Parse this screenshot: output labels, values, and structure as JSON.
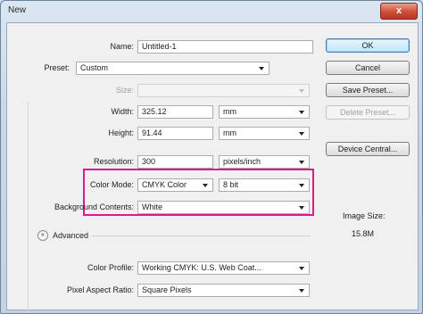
{
  "window": {
    "title": "New",
    "close_glyph": "x"
  },
  "form": {
    "name": {
      "label": "Name:",
      "value": "Untitled-1"
    },
    "preset": {
      "label": "Preset:",
      "value": "Custom"
    },
    "size": {
      "label": "Size:",
      "value": ""
    },
    "width": {
      "label": "Width:",
      "value": "325.12",
      "unit": "mm"
    },
    "height": {
      "label": "Height:",
      "value": "91.44",
      "unit": "mm"
    },
    "resolution": {
      "label": "Resolution:",
      "value": "300",
      "unit": "pixels/inch"
    },
    "color_mode": {
      "label": "Color Mode:",
      "value": "CMYK Color",
      "depth": "8 bit"
    },
    "background": {
      "label": "Background Contents:",
      "value": "White"
    },
    "advanced": {
      "label": "Advanced",
      "toggle_glyph": "«"
    },
    "color_profile": {
      "label": "Color Profile:",
      "value": "Working CMYK: U.S. Web Coat..."
    },
    "pixel_aspect": {
      "label": "Pixel Aspect Ratio:",
      "value": "Square Pixels"
    }
  },
  "buttons": {
    "ok": "OK",
    "cancel": "Cancel",
    "save_preset": "Save Preset...",
    "delete_preset": "Delete Preset...",
    "device_central": "Device Central..."
  },
  "image_size": {
    "label": "Image Size:",
    "value": "15.8M"
  },
  "accent_colors": {
    "highlight": "#e0198b",
    "close": "#cf4c35"
  }
}
